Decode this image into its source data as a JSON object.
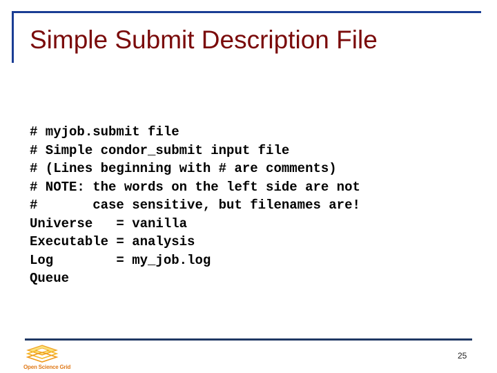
{
  "slide": {
    "title": "Simple Submit Description File",
    "code_lines": [
      "# myjob.submit file",
      "# Simple condor_submit input file",
      "# (Lines beginning with # are comments)",
      "# NOTE: the words on the left side are not",
      "#       case sensitive, but filenames are!",
      "Universe   = vanilla",
      "Executable = analysis",
      "Log        = my_job.log",
      "Queue"
    ],
    "page_number": "25"
  },
  "footer": {
    "logo_icon": "grid-layers-icon",
    "logo_text": "Open Science Grid"
  },
  "colors": {
    "title": "#7a0a0a",
    "top_rule": "#1a3d94",
    "bottom_rule": "#1f3864",
    "logo_text": "#e07a1a",
    "logo_fill": "#f5c518"
  }
}
